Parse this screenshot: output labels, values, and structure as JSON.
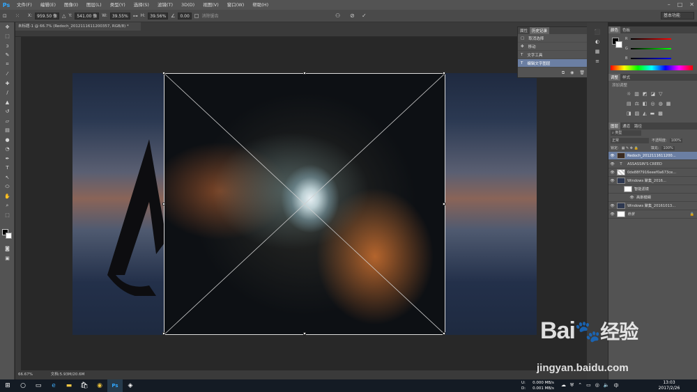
{
  "app": {
    "logo": "Ps"
  },
  "menu": [
    "文件(F)",
    "编辑(E)",
    "图像(I)",
    "图层(L)",
    "类型(Y)",
    "选择(S)",
    "滤镜(T)",
    "3D(D)",
    "视图(V)",
    "窗口(W)",
    "帮助(H)"
  ],
  "options": {
    "x_label": "X:",
    "x_value": "959.50 像",
    "y_label": "Y:",
    "y_value": "541.00 像",
    "w_label": "W:",
    "w_value": "39.55%",
    "h_label": "H:",
    "h_value": "39.56%",
    "angle_value": "0.00",
    "interp_label": "消除锯齿",
    "workspace": "基本功能"
  },
  "document": {
    "tab_title": "未标题-1 @ 66.7% (Redoch_20121116112003​57, RGB/8) *"
  },
  "status": {
    "zoom": "66.67%",
    "doc_info": "文档:5.93M/20.6M"
  },
  "history_panel": {
    "tabs": [
      "属性",
      "历史记录"
    ],
    "items": [
      {
        "label": "取消选择"
      },
      {
        "label": "移动"
      },
      {
        "label": "文字工具"
      },
      {
        "label": "编辑文字图层"
      }
    ]
  },
  "color_panel": {
    "tabs": [
      "颜色",
      "色板"
    ],
    "channels": [
      "R",
      "G",
      "B"
    ]
  },
  "adjust_panel": {
    "tabs": [
      "调整",
      "样式"
    ],
    "add_label": "添加调整"
  },
  "layers_panel": {
    "tabs": [
      "图层",
      "通道",
      "路径"
    ],
    "blend_mode": "正常",
    "opacity_label": "不透明度:",
    "opacity": "100%",
    "lock_label": "锁定:",
    "fill_label": "填充:",
    "fill": "100%",
    "layers": [
      {
        "name": "Redoch_2012111611200...",
        "selected": true
      },
      {
        "name": "ASSASSIN'S CREED",
        "selected": false
      },
      {
        "name": "0de88f7916eeef0a673ce...",
        "selected": false
      },
      {
        "name": "Windows 聚集_2016...",
        "selected": false
      },
      {
        "name": "智能滤镜",
        "selected": false
      },
      {
        "name": "高斯模糊",
        "selected": false
      },
      {
        "name": "Windows 聚集_20161013...",
        "selected": false
      },
      {
        "name": "背景",
        "selected": false
      }
    ]
  },
  "taskbar": {
    "net_up": "0.000 MB/s",
    "net_down": "0.001 MB/s",
    "net_u": "U:",
    "net_d": "D:",
    "time": "13:03",
    "date": "2017/2/26"
  },
  "watermark": {
    "brand": "Bai",
    "brand2": "经验",
    "url": "jingyan.baidu.com"
  }
}
